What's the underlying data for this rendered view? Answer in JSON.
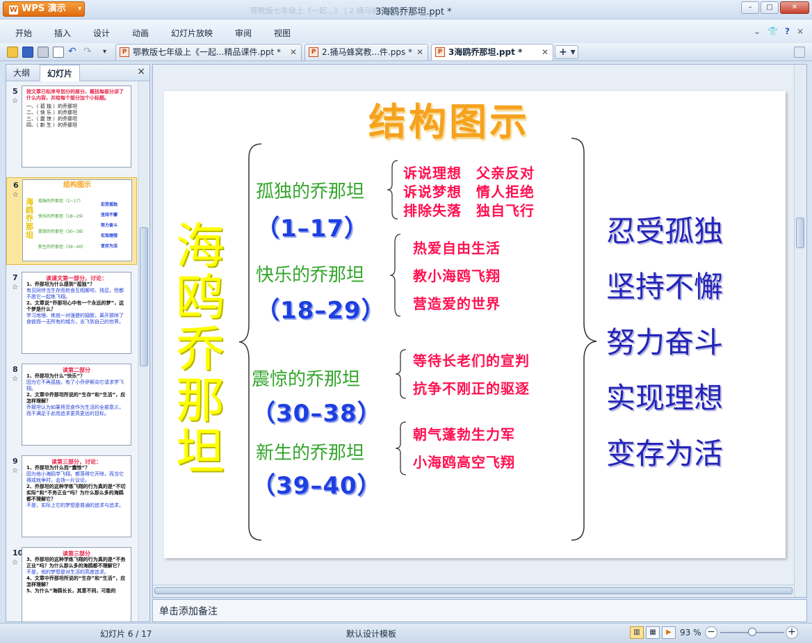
{
  "app": {
    "name": "WPS 演示",
    "title_faded": "鄂教版七年级上《一起...》 | 2.捅马蜂窝教...",
    "document_title": "3海鸥乔那坦.ppt *"
  },
  "window_controls": {
    "minimize": "–",
    "maximize": "□",
    "close": "✕"
  },
  "menu": [
    "开始",
    "插入",
    "设计",
    "动画",
    "幻灯片放映",
    "审阅",
    "视图"
  ],
  "menu_right": {
    "shirt": "👕",
    "help": "?"
  },
  "tabs": [
    {
      "label": "鄂教版七年级上《一起...精品课件.ppt *",
      "icon": "P"
    },
    {
      "label": "2.捅马蜂窝教...件.pps *",
      "icon": "P"
    },
    {
      "label": "3海鸥乔那坦.ppt *",
      "icon": "P"
    }
  ],
  "new_tab": "+ ▾",
  "left_pane": {
    "tabs": [
      "大纲",
      "幻灯片"
    ],
    "close": "×",
    "star": "☆",
    "thumbnails": [
      {
        "num": "5",
        "title": "按文章已标序号划分的部分，概括每部分讲了什么内容，并给每个部分加个小标题。",
        "lines": [
          "一、（    孤 独    ）的乔那坦",
          "二、（    快 乐    ）的乔那坦",
          "三、（    震 惊    ）的乔那坦",
          "四、（    新 生    ）的乔那坦"
        ]
      },
      {
        "num": "6",
        "title": "结构图示",
        "vertical": "海鸥乔那坦",
        "sections": [
          "孤独的乔那坦（1~17）",
          "快乐的乔那坦（18~29）",
          "震惊的乔那坦（30~38）",
          "新生的乔那坦（39~40）"
        ],
        "themes": [
          "忍受孤独",
          "坚持不懈",
          "努力奋斗",
          "实现理想",
          "变存为活"
        ]
      },
      {
        "num": "7",
        "title": "读课文第一部分，讨论：",
        "lines": [
          "1、乔那坦为什么感到“孤独”？",
          "有见同伴当生存而抢食互相厮咬、残忍，但都不愿它一起练飞翔。",
          "2、文章说“乔那坦心中有一个永远的梦”，这个梦是什么？",
          "学习地理、练就一对强健的翅膀，离开那除了食欲而一无所有的城方，去飞到自己的世界。"
        ]
      },
      {
        "num": "8",
        "title": "读第二部分",
        "lines": [
          "1、乔那坦为什么“快乐”？",
          "因为它不再孤独，有了小乔伊斯向它请求学飞翔。",
          "2、文章中乔那坦所说的“生存”和“生活”，应怎样理解？",
          "乔那坦认为如果将觅食作为生活的全部意义，而不满足于此而追求更高更远的目标。"
        ]
      },
      {
        "num": "9",
        "title": "读第三部分，讨论：",
        "lines": [
          "1、乔那坦为什么而“震惊”？",
          "因为他小海鸥学飞翔，都落得它开除，而当它得成就争时，会场一片议论。",
          "2、乔那坦的这种学练飞翔的行为真的是“不切实际”和“不务正业”吗？为什么那么多的海鸥都不理解它？",
          "不是，实际上它的梦想是普通的追求与追求。"
        ]
      },
      {
        "num": "10",
        "title": "读第三部分",
        "lines": [
          "3、乔那坦的这种学练飞翔的行为真的是“不务正业”吗？为什么那么多的海鸥都不理解它？",
          "不是，他的梦想是对生活的高度追求。",
          "4、文章中乔那坦所说的“生存”和“生活”，应怎样理解？",
          "5、为什么“海鸥长长，其意不同，可能的"
        ]
      }
    ]
  },
  "slide": {
    "title": "结构图示",
    "vertical_title": "海鸥乔那坦",
    "sections": [
      {
        "name": "孤独的乔那坦",
        "range": "（1–17）",
        "details": [
          "诉说理想　父亲反对",
          "诉说梦想　情人拒绝",
          "排除失落　独自飞行"
        ]
      },
      {
        "name": "快乐的乔那坦",
        "range": "（18–29）",
        "details": [
          "热爱自由生活",
          "教小海鸥飞翔",
          "营造爱的世界"
        ]
      },
      {
        "name": "震惊的乔那坦",
        "range": "（30–38）",
        "details": [
          "等待长老们的宣判",
          "抗争不刚正的驱逐"
        ]
      },
      {
        "name": "新生的乔那坦",
        "range": "（39–40）",
        "details": [
          "朝气蓬勃生力军",
          "小海鸥高空飞翔"
        ]
      }
    ],
    "themes": [
      "忍受孤独",
      "坚持不懈",
      "努力奋斗",
      "实现理想",
      "变存为活"
    ]
  },
  "notes_placeholder": "单击添加备注",
  "status": {
    "slide_info": "幻灯片 6 / 17",
    "template": "默认设计模板",
    "zoom": "93 %",
    "zoom_level": 0.5,
    "zoom_minus": "−",
    "zoom_plus": "+"
  },
  "colors": {
    "title_orange": "#f7a21d",
    "vertical_yellow": "#ffff00",
    "section_green": "#33a52b",
    "range_blue": "#1e3fe0",
    "detail_red": "#ff1050",
    "theme_navy": "#2424b8"
  }
}
